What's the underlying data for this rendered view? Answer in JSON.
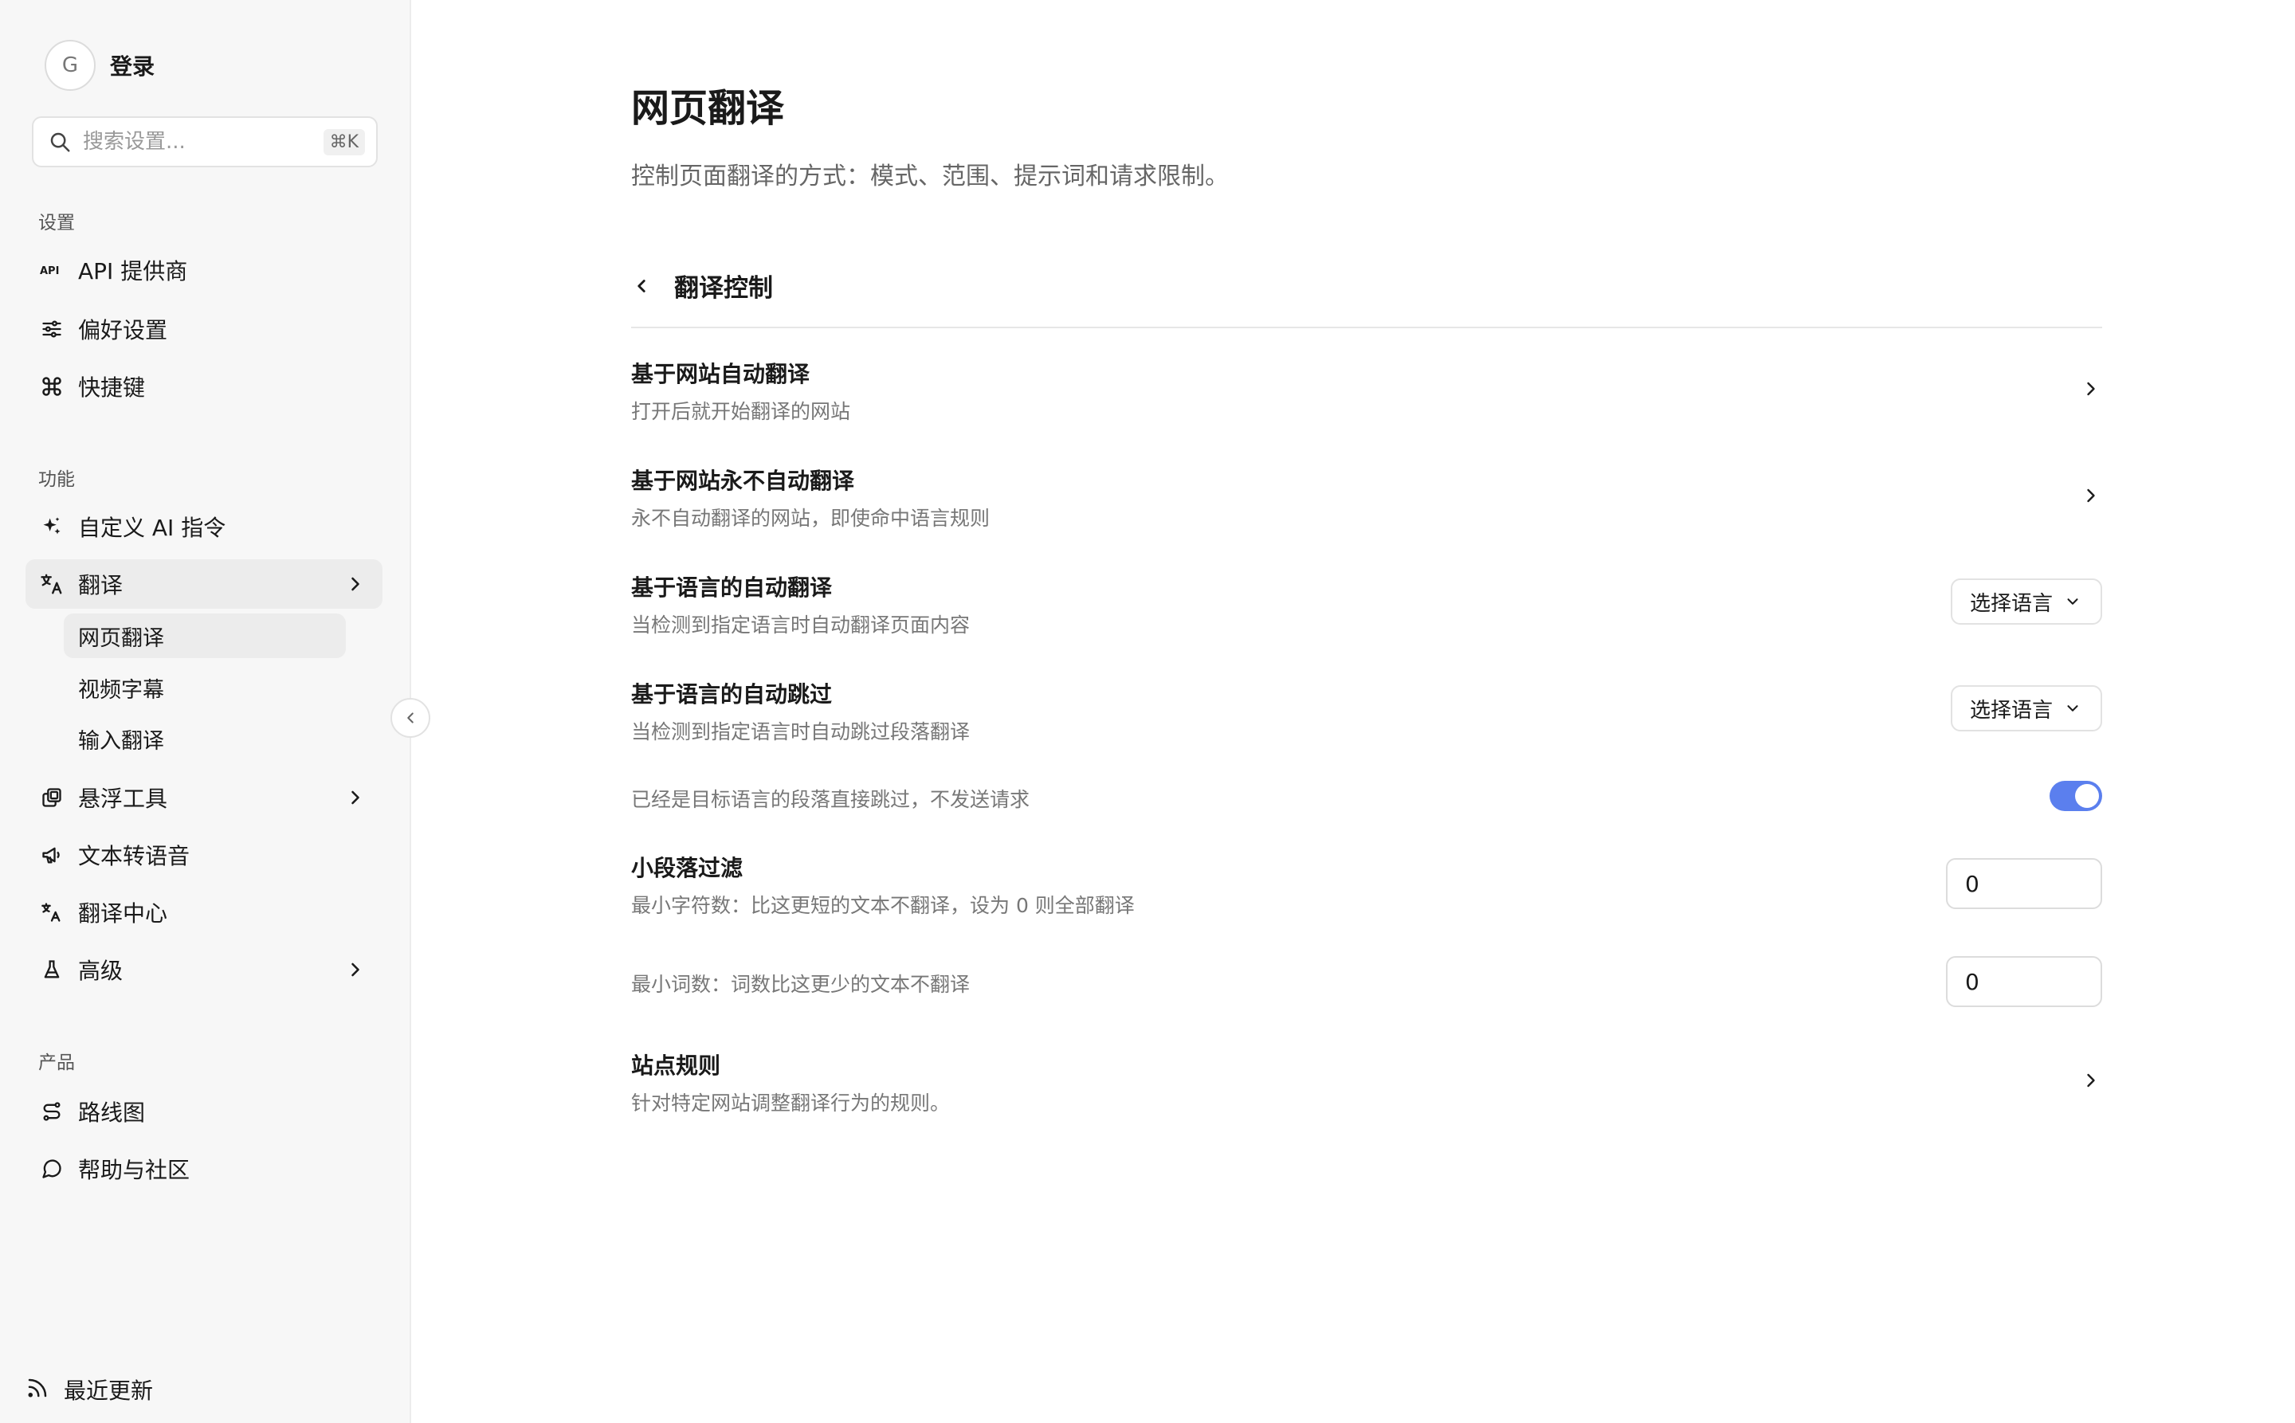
{
  "user": {
    "avatar_initial": "G",
    "login_label": "登录"
  },
  "search": {
    "placeholder": "搜索设置...",
    "shortcut": "⌘K"
  },
  "sidebar": {
    "sections": [
      {
        "label": "设置"
      },
      {
        "label": "功能"
      },
      {
        "label": "产品"
      }
    ],
    "settings_items": [
      {
        "label": "API 提供商",
        "icon": "api-icon"
      },
      {
        "label": "偏好设置",
        "icon": "sliders-icon"
      },
      {
        "label": "快捷键",
        "icon": "command-icon"
      }
    ],
    "feature_items": [
      {
        "label": "自定义 AI 指令",
        "icon": "sparkles-icon"
      },
      {
        "label": "翻译",
        "icon": "translate-icon",
        "expanded": true
      },
      {
        "label": "悬浮工具",
        "icon": "layers-icon"
      },
      {
        "label": "文本转语音",
        "icon": "megaphone-icon"
      },
      {
        "label": "翻译中心",
        "icon": "language-icon"
      },
      {
        "label": "高级",
        "icon": "flask-icon"
      }
    ],
    "translate_sub_items": [
      {
        "label": "网页翻译",
        "active": true
      },
      {
        "label": "视频字幕"
      },
      {
        "label": "输入翻译"
      }
    ],
    "product_items": [
      {
        "label": "路线图",
        "icon": "route-icon"
      },
      {
        "label": "帮助与社区",
        "icon": "chat-icon"
      }
    ],
    "footer": {
      "label": "最近更新",
      "icon": "rss-icon"
    }
  },
  "main": {
    "title": "网页翻译",
    "description": "控制页面翻译的方式：模式、范围、提示词和请求限制。",
    "section_title": "翻译控制",
    "rows": {
      "auto_by_site": {
        "title": "基于网站自动翻译",
        "desc": "打开后就开始翻译的网站"
      },
      "never_by_site": {
        "title": "基于网站永不自动翻译",
        "desc": "永不自动翻译的网站，即使命中语言规则"
      },
      "auto_by_lang": {
        "title": "基于语言的自动翻译",
        "desc": "当检测到指定语言时自动翻译页面内容",
        "select_label": "选择语言"
      },
      "skip_by_lang": {
        "title": "基于语言的自动跳过",
        "desc": "当检测到指定语言时自动跳过段落翻译",
        "select_label": "选择语言"
      },
      "skip_target": {
        "desc": "已经是目标语言的段落直接跳过，不发送请求",
        "enabled": true
      },
      "small_filter": {
        "title": "小段落过滤",
        "min_chars_desc": "最小字符数：比这更短的文本不翻译，设为 0 则全部翻译",
        "min_chars_value": "0",
        "min_words_desc": "最小词数：词数比这更少的文本不翻译",
        "min_words_value": "0"
      },
      "site_rules": {
        "title": "站点规则",
        "desc": "针对特定网站调整翻译行为的规则。"
      }
    }
  },
  "colors": {
    "accent": "#5b7fee",
    "sidebar_bg": "#f7f7f7",
    "active_bg": "#ececec"
  }
}
